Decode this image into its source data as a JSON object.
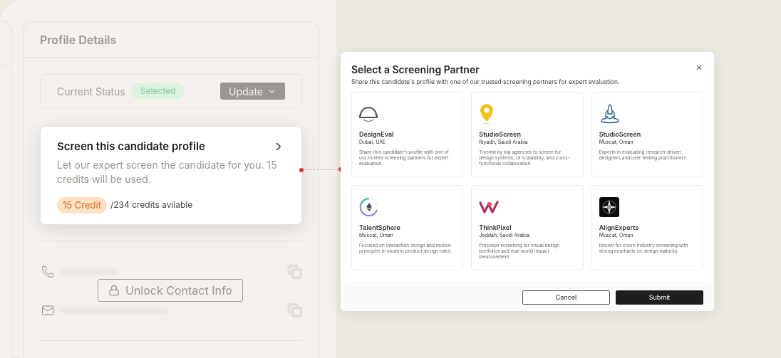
{
  "profile": {
    "title": "Profile Details",
    "status_label": "Current Status",
    "status": "Selected",
    "update_button": "Update",
    "screen_card": {
      "title": "Screen this candidate profile",
      "description": "Let our expert screen the candidate for you. 15 credits will be used.",
      "credit": "15 Credit",
      "available": "/234 credits avilable"
    },
    "unlock_button": "Unlock Contact Info"
  },
  "modal": {
    "title": "Select a Screening Partner",
    "subtitle": "Share this candidate's profile with one of our trusted screening partners for expert evaluation.",
    "partners": [
      {
        "kind": "helmet",
        "name": "DesignEval",
        "location": "Dubai, UAE",
        "description": "Share this candidate's profile with one of our trusted screening partners for expert evaluation."
      },
      {
        "kind": "pin",
        "name": "StudioScreen",
        "location": "Riyadh, Saudi Arabia",
        "description": "Trusted by top agencies to screen for design systems, UI scalability, and cross-functional collaboration."
      },
      {
        "kind": "rocket",
        "name": "StudioScreen",
        "location": "Muscat, Oman",
        "description": "Experts in evaluating research-driven designers and user testing practitioners."
      },
      {
        "kind": "sphere",
        "name": "TalentSphere",
        "location": "Muscat, Oman",
        "description": "Focused on interaction design and motion principles in modern product design roles."
      },
      {
        "kind": "wave",
        "name": "ThinkPixel",
        "location": "Jeddah, Saudi Arabia",
        "description": "Precision screening for visual design portfolios and real-world impact measurement"
      },
      {
        "kind": "compass",
        "name": "AlignExperts",
        "location": "Muscat, Oman",
        "description": "Known for cross-industry screening with strong emphasis on design maturity."
      }
    ],
    "cancel": "Cancel",
    "submit": "Submit"
  }
}
